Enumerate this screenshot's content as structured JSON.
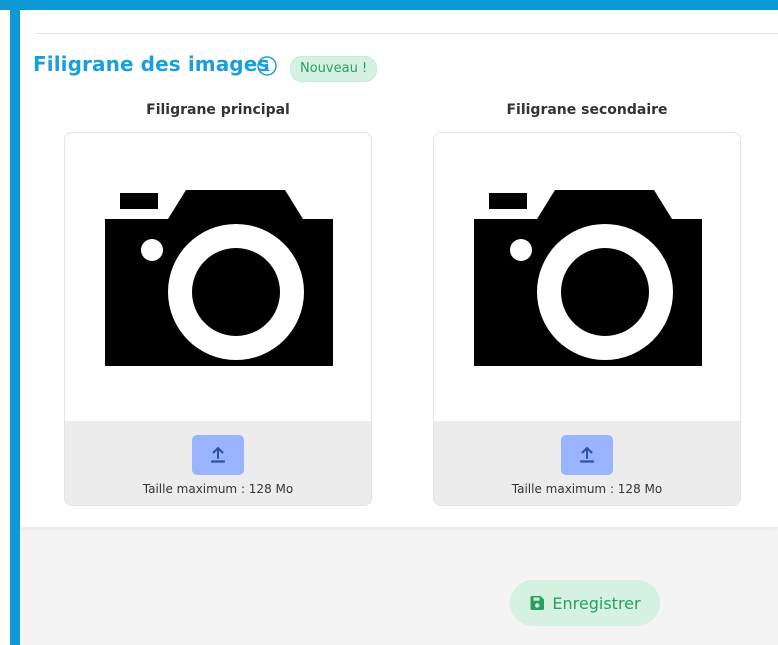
{
  "section": {
    "title": "Filigrane des images",
    "badge": "Nouveau !"
  },
  "watermarks": [
    {
      "title": "Filigrane principal",
      "max_size": "Taille maximum : 128 Mo",
      "preview_icon": "camera-icon",
      "upload_icon": "upload-icon"
    },
    {
      "title": "Filigrane secondaire",
      "max_size": "Taille maximum : 128 Mo",
      "preview_icon": "camera-icon",
      "upload_icon": "upload-icon"
    }
  ],
  "actions": {
    "save_label": "Enregistrer",
    "save_icon": "save-icon"
  },
  "colors": {
    "accent": "#1a9fd9",
    "frame": "#0f9ad6",
    "badge_bg": "#d4f1e2",
    "badge_text": "#2b9d63",
    "upload_button": "#9ab3ff",
    "panel_footer": "#ececec"
  }
}
